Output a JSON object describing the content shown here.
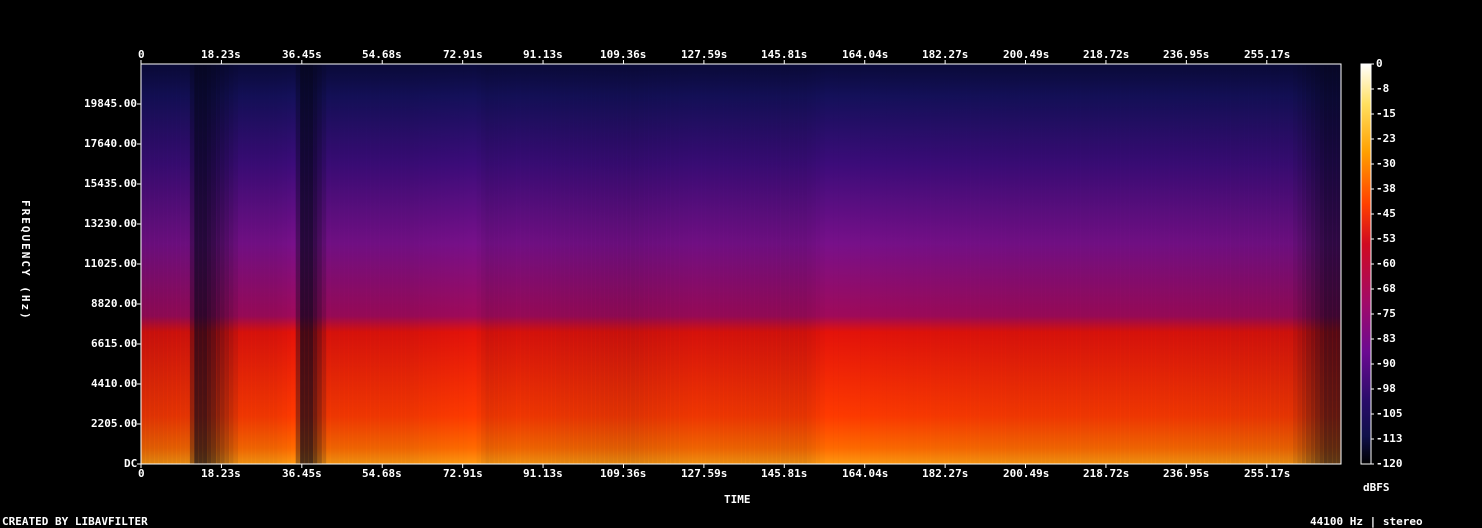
{
  "chart_data": {
    "type": "heatmap",
    "title": "",
    "xlabel": "TIME",
    "ylabel": "FREQUENCY (Hz)",
    "x_ticks": [
      "0",
      "18.23s",
      "36.45s",
      "54.68s",
      "72.91s",
      "91.13s",
      "109.36s",
      "127.59s",
      "145.81s",
      "164.04s",
      "182.27s",
      "200.49s",
      "218.72s",
      "236.95s",
      "255.17s"
    ],
    "x_tick_values_s": [
      0,
      18.23,
      36.45,
      54.68,
      72.91,
      91.13,
      109.36,
      127.59,
      145.81,
      164.04,
      182.27,
      200.49,
      218.72,
      236.95,
      255.17
    ],
    "xlim_s": [
      0,
      272
    ],
    "y_ticks": [
      "DC",
      "2205.00",
      "4410.00",
      "6615.00",
      "8820.00",
      "11025.00",
      "13230.00",
      "15435.00",
      "17640.00",
      "19845.00"
    ],
    "y_tick_values_hz": [
      0,
      2205,
      4410,
      6615,
      8820,
      11025,
      13230,
      15435,
      17640,
      19845
    ],
    "ylim_hz": [
      0,
      22050
    ],
    "colorbar": {
      "label": "dBFS",
      "ticks": [
        "0",
        "-8",
        "-15",
        "-23",
        "-30",
        "-38",
        "-45",
        "-53",
        "-60",
        "-68",
        "-75",
        "-83",
        "-90",
        "-98",
        "-105",
        "-113",
        "-120"
      ],
      "range_db": [
        -120,
        0
      ],
      "colors": [
        "#000000",
        "#10104a",
        "#3a0a7a",
        "#6b0a92",
        "#9a0a70",
        "#d00a20",
        "#ff3000",
        "#ff9000",
        "#ffd040",
        "#ffffff"
      ]
    },
    "energy_profile_db": {
      "time_s": [
        0,
        10,
        12,
        14,
        22,
        30,
        34,
        36,
        38,
        42,
        60,
        75,
        78,
        85,
        100,
        110,
        125,
        150,
        155,
        170,
        200,
        230,
        260,
        268,
        272
      ],
      "level_db": [
        -60,
        -58,
        -100,
        -100,
        -55,
        -55,
        -50,
        -100,
        -100,
        -55,
        -55,
        -50,
        -58,
        -55,
        -58,
        -60,
        -55,
        -58,
        -50,
        -52,
        -55,
        -55,
        -58,
        -95,
        -95
      ]
    },
    "grid": false,
    "legend": "colorbar-right"
  },
  "footer": {
    "credit": "CREATED BY LIBAVFILTER",
    "format": "44100 Hz | stereo"
  }
}
